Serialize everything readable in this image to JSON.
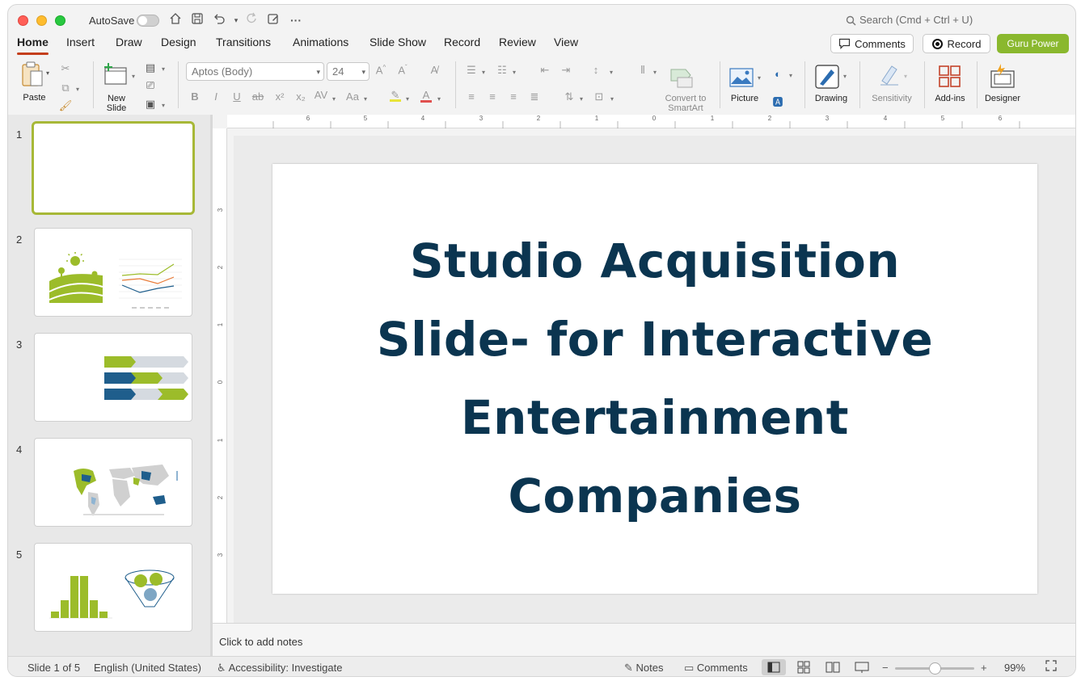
{
  "titlebar": {
    "autosave_label": "AutoSave",
    "search_placeholder": "Search (Cmd + Ctrl + U)"
  },
  "tabs": [
    {
      "label": "Home",
      "active": true
    },
    {
      "label": "Insert"
    },
    {
      "label": "Draw"
    },
    {
      "label": "Design"
    },
    {
      "label": "Transitions"
    },
    {
      "label": "Animations"
    },
    {
      "label": "Slide Show"
    },
    {
      "label": "Record"
    },
    {
      "label": "Review"
    },
    {
      "label": "View"
    }
  ],
  "header_buttons": {
    "comments": "Comments",
    "record": "Record",
    "guru": "Guru Power",
    "guru_color": "#8ab82e"
  },
  "ribbon": {
    "paste": "Paste",
    "new_slide": "New Slide",
    "font_name": "Aptos (Body)",
    "font_size": "24",
    "convert_smartart": "Convert to SmartArt",
    "picture": "Picture",
    "drawing": "Drawing",
    "sensitivity": "Sensitivity",
    "addins": "Add-ins",
    "designer": "Designer"
  },
  "thumbnails": [
    {
      "number": "1",
      "selected": true
    },
    {
      "number": "2"
    },
    {
      "number": "3"
    },
    {
      "number": "4"
    },
    {
      "number": "5"
    }
  ],
  "slide": {
    "title": "Studio Acquisition Slide- for Interactive Entertainment Companies",
    "title_color": "#0b3550"
  },
  "notes_placeholder": "Click to add notes",
  "status": {
    "slide_info": "Slide 1 of 5",
    "language": "English (United States)",
    "accessibility": "Accessibility: Investigate",
    "notes": "Notes",
    "comments": "Comments",
    "zoom": "99%"
  }
}
